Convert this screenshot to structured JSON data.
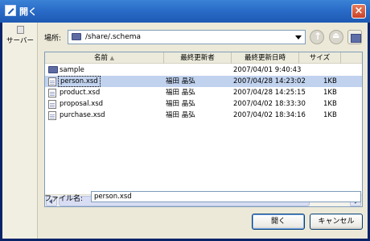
{
  "window": {
    "title": "開く"
  },
  "places": {
    "items": [
      {
        "label": "サーバー",
        "icon": "server-icon"
      }
    ]
  },
  "lookin": {
    "label": "場所:",
    "path": "/share/.schema"
  },
  "list": {
    "columns": [
      "名前",
      "最終更新者",
      "最終更新日時",
      "サイズ"
    ],
    "rows": [
      {
        "name": "sample",
        "type": "folder",
        "owner": "",
        "date": "2007/04/01 9:40:43",
        "size": "",
        "selected": false
      },
      {
        "name": "person.xsd",
        "type": "file",
        "owner": "福田 晶弘",
        "date": "2007/04/28 14:23:02",
        "size": "1KB",
        "selected": true
      },
      {
        "name": "product.xsd",
        "type": "file",
        "owner": "福田 晶弘",
        "date": "2007/04/28 14:25:15",
        "size": "1KB",
        "selected": false
      },
      {
        "name": "proposal.xsd",
        "type": "file",
        "owner": "福田 晶弘",
        "date": "2007/04/02 18:33:30",
        "size": "1KB",
        "selected": false
      },
      {
        "name": "purchase.xsd",
        "type": "file",
        "owner": "福田 晶弘",
        "date": "2007/04/02 18:34:16",
        "size": "1KB",
        "selected": false
      }
    ]
  },
  "filename": {
    "label": "ファイル名:",
    "value": "person.xsd"
  },
  "buttons": {
    "open": "開く",
    "cancel": "キャンセル"
  },
  "colors": {
    "titlebar": "#2a6cc8",
    "selection": "#c1d2ee",
    "dialog_bg": "#ece9d8"
  }
}
